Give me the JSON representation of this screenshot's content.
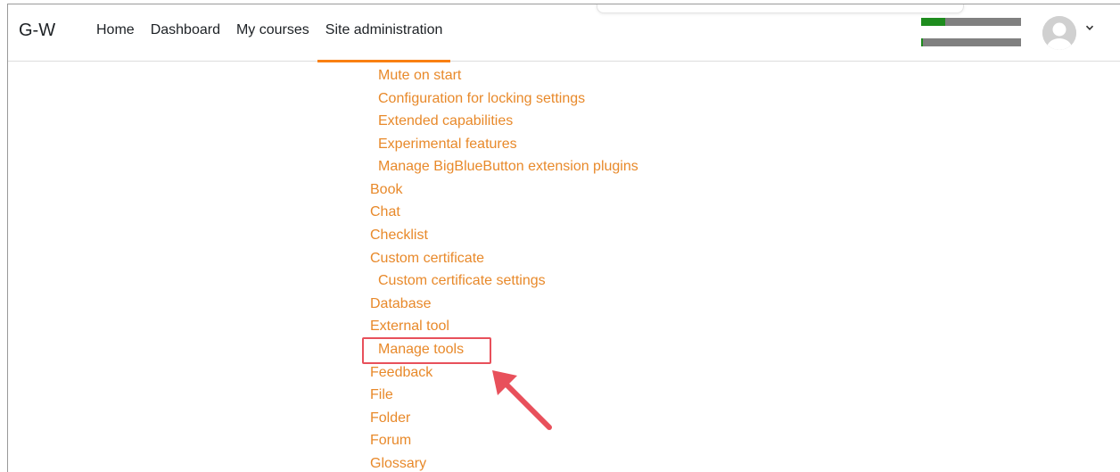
{
  "header": {
    "brand": "G-W",
    "nav": [
      {
        "label": "Home",
        "active": false
      },
      {
        "label": "Dashboard",
        "active": false
      },
      {
        "label": "My courses",
        "active": false
      },
      {
        "label": "Site administration",
        "active": true
      }
    ],
    "accent_color": "#f98012",
    "progress_meters": [
      0.24,
      0.02
    ],
    "meter_fill_color": "#1e8c1e",
    "meter_track_color": "#808080",
    "avatar_icon": "user-avatar-icon",
    "menu_icon": "chevron-down-icon"
  },
  "tree": {
    "link_color": "#e8892a",
    "items": [
      {
        "label": "Mute on start",
        "level": 2
      },
      {
        "label": "Configuration for locking settings",
        "level": 2
      },
      {
        "label": "Extended capabilities",
        "level": 2
      },
      {
        "label": "Experimental features",
        "level": 2
      },
      {
        "label": "Manage BigBlueButton extension plugins",
        "level": 2
      },
      {
        "label": "Book",
        "level": 1
      },
      {
        "label": "Chat",
        "level": 1
      },
      {
        "label": "Checklist",
        "level": 1
      },
      {
        "label": "Custom certificate",
        "level": 1
      },
      {
        "label": "Custom certificate settings",
        "level": 2
      },
      {
        "label": "Database",
        "level": 1
      },
      {
        "label": "External tool",
        "level": 1
      },
      {
        "label": "Manage tools",
        "level": 2
      },
      {
        "label": "Feedback",
        "level": 1
      },
      {
        "label": "File",
        "level": 1
      },
      {
        "label": "Folder",
        "level": 1
      },
      {
        "label": "Forum",
        "level": 1
      },
      {
        "label": "Glossary",
        "level": 1
      }
    ]
  },
  "annotation": {
    "highlight_color": "#e8505b",
    "highlighted_item": "Manage tools"
  }
}
